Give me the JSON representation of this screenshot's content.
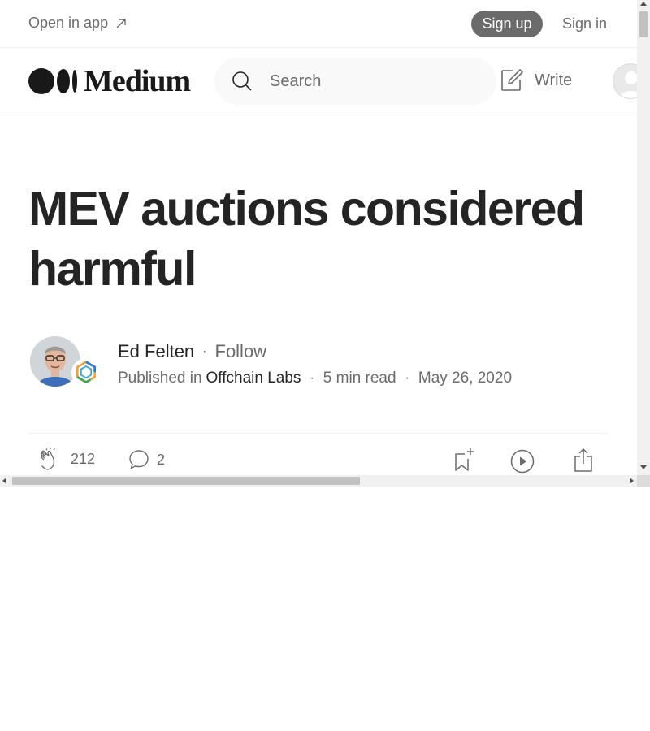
{
  "topbar": {
    "open_in_app": "Open in app",
    "sign_up": "Sign up",
    "sign_in": "Sign in"
  },
  "header": {
    "logo_text": "Medium",
    "search_placeholder": "Search",
    "write_label": "Write"
  },
  "article": {
    "title": "MEV auctions considered harmful",
    "author": "Ed Felten",
    "follow": "Follow",
    "published_in_prefix": "Published in",
    "publication": "Offchain Labs",
    "read_time": "5 min read",
    "date": "May 26, 2020",
    "dot": "·"
  },
  "actions": {
    "claps": "212",
    "responses": "2"
  },
  "icons": {
    "open_in_app": "arrow-up-right-icon",
    "search": "search-icon",
    "write": "write-icon",
    "clap": "clap-icon",
    "response": "response-icon",
    "bookmark": "bookmark-add-icon",
    "listen": "play-icon",
    "share": "share-icon"
  },
  "colors": {
    "text": "#242424",
    "muted": "#6b6b6b",
    "signup_bg": "#6b6b6b",
    "search_bg": "#f9f9f9"
  }
}
